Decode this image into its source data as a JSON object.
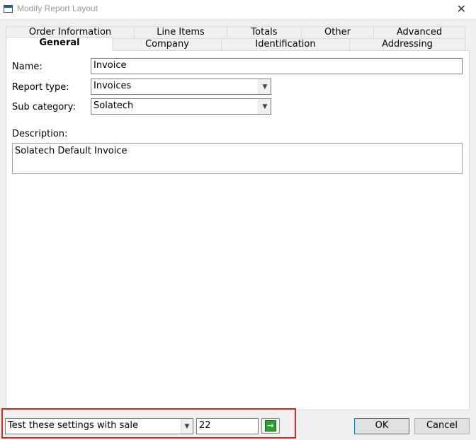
{
  "window": {
    "title": "Modify Report Layout",
    "close_glyph": "✕"
  },
  "tabs": {
    "row1": [
      "Order Information",
      "Line Items",
      "Totals",
      "Other",
      "Advanced"
    ],
    "row2": [
      "General",
      "Company",
      "Identification",
      "Addressing"
    ],
    "active": "General"
  },
  "general": {
    "name_label": "Name:",
    "name_value": "Invoice",
    "report_type_label": "Report type:",
    "report_type_value": "Invoices",
    "sub_category_label": "Sub category:",
    "sub_category_value": "Solatech",
    "description_label": "Description:",
    "description_value": "Solatech Default Invoice"
  },
  "footer": {
    "test_select_value": "Test these settings with sale",
    "sale_number_value": "22",
    "ok_label": "OK",
    "cancel_label": "Cancel"
  },
  "icons": {
    "go": "arrow-right-icon",
    "dropdown": "chevron-down-icon",
    "app": "window-icon"
  },
  "colors": {
    "highlight_border": "#d42a2a",
    "go_button": "#2aa12a",
    "default_button_border": "#0078d7"
  }
}
